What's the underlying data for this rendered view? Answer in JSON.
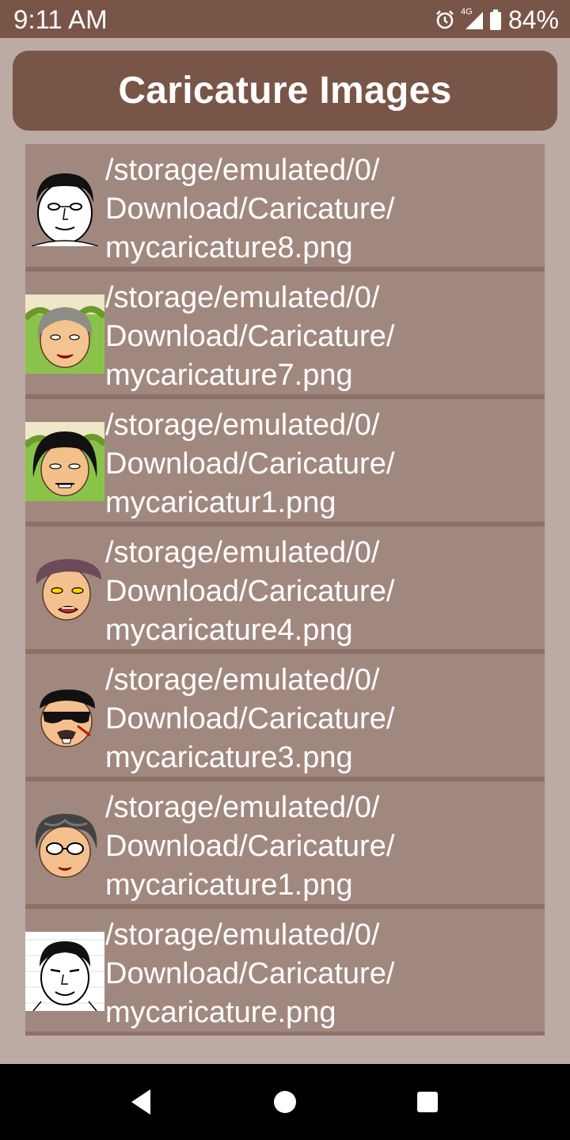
{
  "status": {
    "time": "9:11 AM",
    "network": "4G",
    "battery": "84%"
  },
  "header": {
    "title": "Caricature Images"
  },
  "items": [
    {
      "path": "/storage/emulated/0/\nDownload/Caricature/\nmycaricature8.png",
      "thumb": "caricature-thumbnail-8"
    },
    {
      "path": "/storage/emulated/0/\nDownload/Caricature/\nmycaricature7.png",
      "thumb": "caricature-thumbnail-7"
    },
    {
      "path": "/storage/emulated/0/\nDownload/Caricature/\nmycaricatur1.png",
      "thumb": "caricature-thumbnail-1b"
    },
    {
      "path": "/storage/emulated/0/\nDownload/Caricature/\nmycaricature4.png",
      "thumb": "caricature-thumbnail-4"
    },
    {
      "path": "/storage/emulated/0/\nDownload/Caricature/\nmycaricature3.png",
      "thumb": "caricature-thumbnail-3"
    },
    {
      "path": "/storage/emulated/0/\nDownload/Caricature/\nmycaricature1.png",
      "thumb": "caricature-thumbnail-1"
    },
    {
      "path": "/storage/emulated/0/\nDownload/Caricature/\nmycaricature.png",
      "thumb": "caricature-thumbnail-0"
    }
  ],
  "colors": {
    "primary": "#795548",
    "background": "#bcaaa4",
    "item": "#a1887f"
  }
}
